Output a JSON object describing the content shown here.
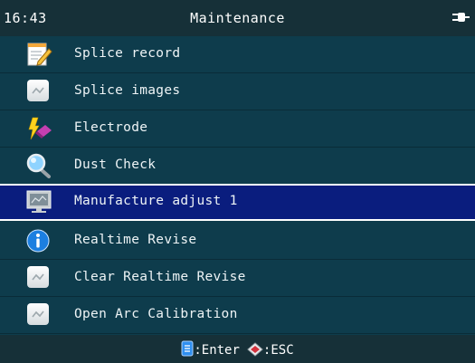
{
  "status_bar": {
    "time": "16:43",
    "title": "Maintenance",
    "power_icon": "plug-icon"
  },
  "menu": {
    "items": [
      {
        "label": "Splice record",
        "icon": "notepad-pencil-icon",
        "selected": false
      },
      {
        "label": "Splice images",
        "icon": "image-icon",
        "selected": false
      },
      {
        "label": "Electrode",
        "icon": "lightning-electrode-icon",
        "selected": false
      },
      {
        "label": "Dust Check",
        "icon": "magnifier-icon",
        "selected": false
      },
      {
        "label": "Manufacture adjust 1",
        "icon": "monitor-icon",
        "selected": true
      },
      {
        "label": "Realtime Revise",
        "icon": "info-icon",
        "selected": false
      },
      {
        "label": "Clear Realtime Revise",
        "icon": "image-icon",
        "selected": false
      },
      {
        "label": "Open Arc Calibration",
        "icon": "image-icon",
        "selected": false
      }
    ]
  },
  "footer": {
    "enter_label": ":Enter",
    "esc_label": ":ESC",
    "enter_icon": "enter-key-icon",
    "esc_icon": "esc-key-icon"
  },
  "colors": {
    "background": "#0e3c4c",
    "bar": "#163038",
    "selected": "#0a1d7e",
    "text": "#eef4f6"
  }
}
